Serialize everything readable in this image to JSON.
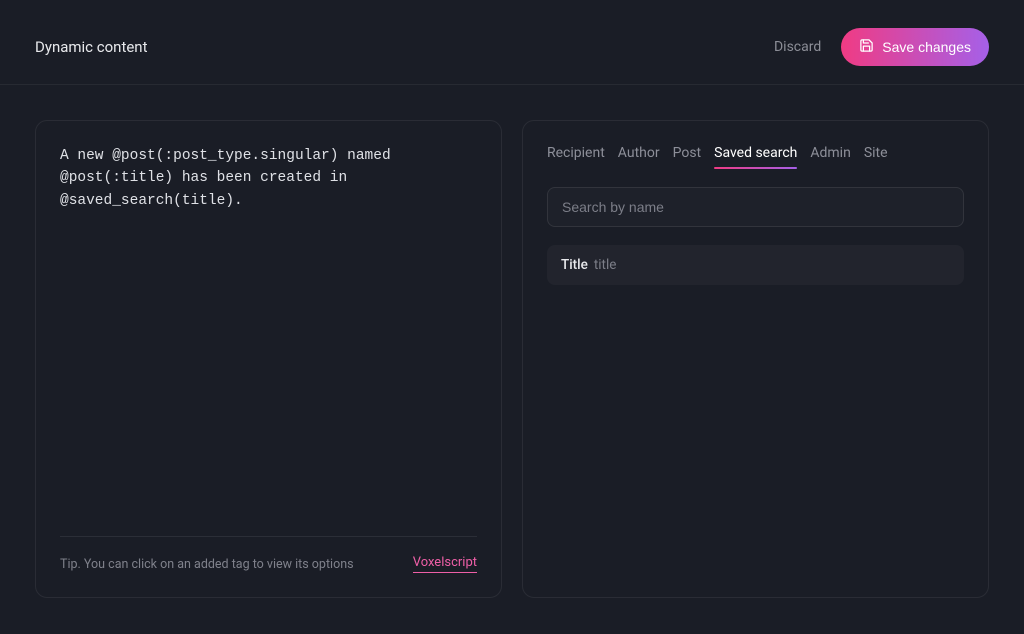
{
  "header": {
    "title": "Dynamic content",
    "discard_label": "Discard",
    "save_label": "Save changes"
  },
  "editor": {
    "code": "A new @post(:post_type.singular) named @post(:title) has been created in @saved_search(title).",
    "tip": "Tip. You can click on an added tag to view its options",
    "script_link": "Voxelscript"
  },
  "tabs": [
    {
      "label": "Recipient",
      "active": false
    },
    {
      "label": "Author",
      "active": false
    },
    {
      "label": "Post",
      "active": false
    },
    {
      "label": "Saved search",
      "active": true
    },
    {
      "label": "Admin",
      "active": false
    },
    {
      "label": "Site",
      "active": false
    }
  ],
  "search": {
    "placeholder": "Search by name"
  },
  "results": [
    {
      "name": "Title",
      "slug": "title"
    }
  ]
}
